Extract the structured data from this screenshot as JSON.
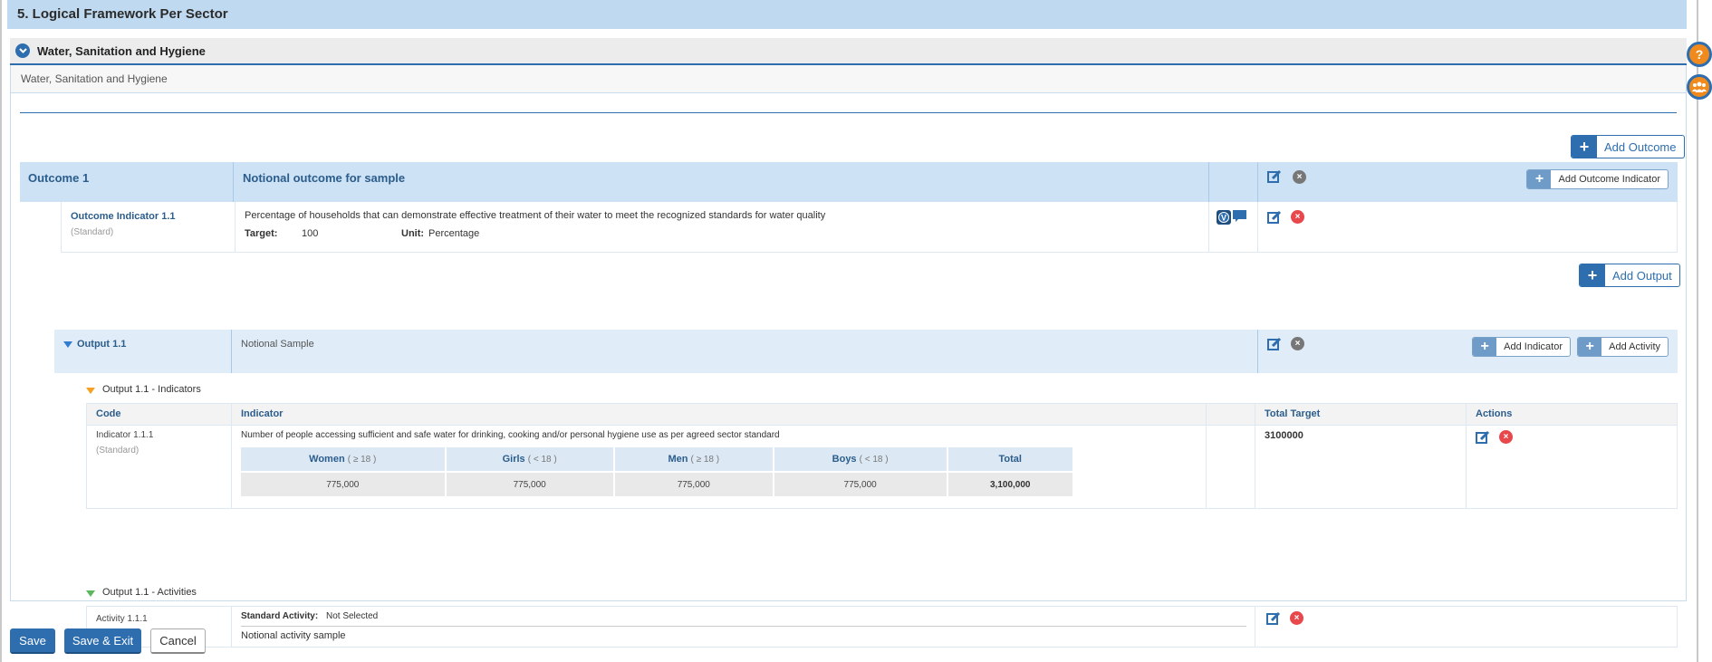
{
  "section": {
    "title": "5. Logical Framework Per Sector"
  },
  "sector": {
    "header": "Water, Sanitation and Hygiene",
    "subtitle": "Water, Sanitation and Hygiene"
  },
  "buttons": {
    "add_outcome": "Add Outcome",
    "add_outcome_indicator": "Add Outcome Indicator",
    "add_output": "Add Output",
    "add_indicator": "Add Indicator",
    "add_activity": "Add Activity",
    "save": "Save",
    "save_exit": "Save & Exit",
    "cancel": "Cancel"
  },
  "outcome": {
    "code": "Outcome 1",
    "description": "Notional outcome for sample",
    "indicator": {
      "code": "Outcome Indicator 1.1",
      "type": "(Standard)",
      "description": "Percentage of households that can demonstrate effective treatment of their water to meet the recognized standards for water quality",
      "target_label": "Target:",
      "target_value": "100",
      "unit_label": "Unit:",
      "unit_value": "Percentage"
    }
  },
  "output": {
    "code": "Output 1.1",
    "description": "Notional Sample",
    "indicators_label": "Output 1.1 - Indicators",
    "activities_label": "Output 1.1 - Activities",
    "indicator_table": {
      "headers": {
        "code": "Code",
        "indicator": "Indicator",
        "total_target": "Total Target",
        "actions": "Actions"
      },
      "row": {
        "code": "Indicator 1.1.1",
        "type": "(Standard)",
        "description": "Number of people accessing sufficient and safe water for drinking, cooking and/or personal hygiene use as per agreed sector standard",
        "total_target": "3100000",
        "breakdown": {
          "headers": [
            {
              "label": "Women",
              "qual": "( ≥ 18 )"
            },
            {
              "label": "Girls",
              "qual": "( < 18 )"
            },
            {
              "label": "Men",
              "qual": "( ≥ 18 )"
            },
            {
              "label": "Boys",
              "qual": "( < 18 )"
            },
            {
              "label": "Total",
              "qual": ""
            }
          ],
          "values": [
            "775,000",
            "775,000",
            "775,000",
            "775,000",
            "3,100,000"
          ]
        }
      }
    },
    "activity": {
      "code": "Activity 1.1.1",
      "standard_label": "Standard Activity:",
      "standard_value": "Not Selected",
      "description": "Notional activity sample"
    }
  },
  "floating": {
    "help": "?",
    "users": "users"
  }
}
